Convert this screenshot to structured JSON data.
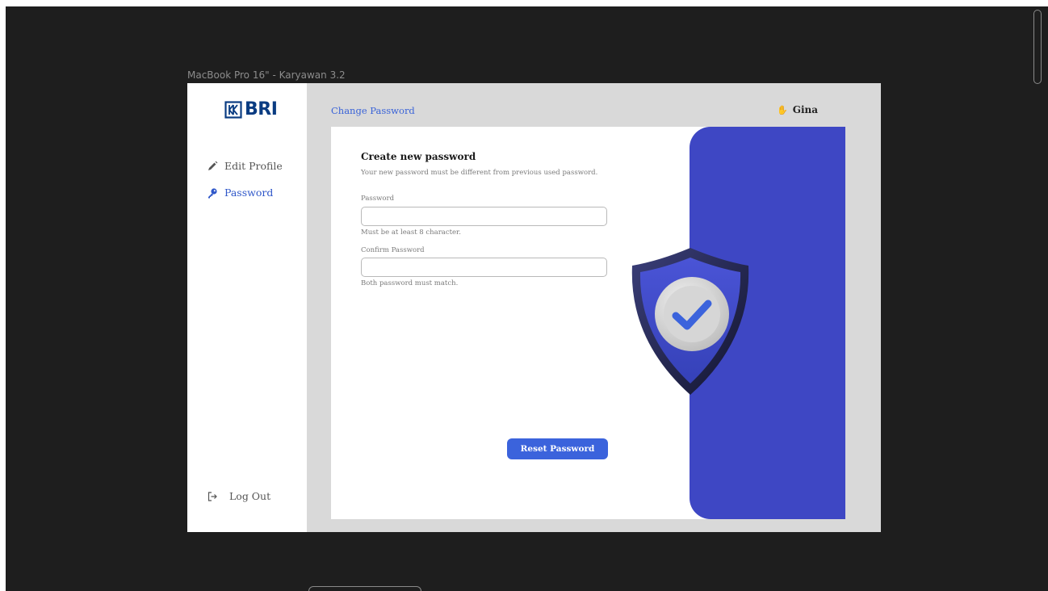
{
  "frame_label": "MacBook Pro 16\" - Karyawan 3.2",
  "brand": {
    "logo_text": "BRI",
    "color": "#0a3c82"
  },
  "sidebar": {
    "items": [
      {
        "label": "Edit Profile",
        "icon": "pencil-icon"
      },
      {
        "label": "Password",
        "icon": "key-icon",
        "active": true
      }
    ],
    "logout": {
      "label": "Log Out",
      "icon": "logout-icon"
    }
  },
  "header": {
    "title": "Change Password",
    "user": {
      "name": "Gina",
      "icon": "wave-hand-icon"
    }
  },
  "form": {
    "title": "Create new password",
    "subtitle": "Your new password must be different from previous used password.",
    "password": {
      "label": "Password",
      "value": "",
      "placeholder": "",
      "hint": "Must be at least 8 character."
    },
    "confirm": {
      "label": "Confirm Password",
      "value": "",
      "placeholder": "",
      "hint": "Both password must match."
    },
    "submit_label": "Reset Password"
  },
  "colors": {
    "accent": "#3b63dc",
    "panel": "#3e47c4",
    "active_nav": "#2f57c9",
    "background": "#1e1e1e"
  }
}
